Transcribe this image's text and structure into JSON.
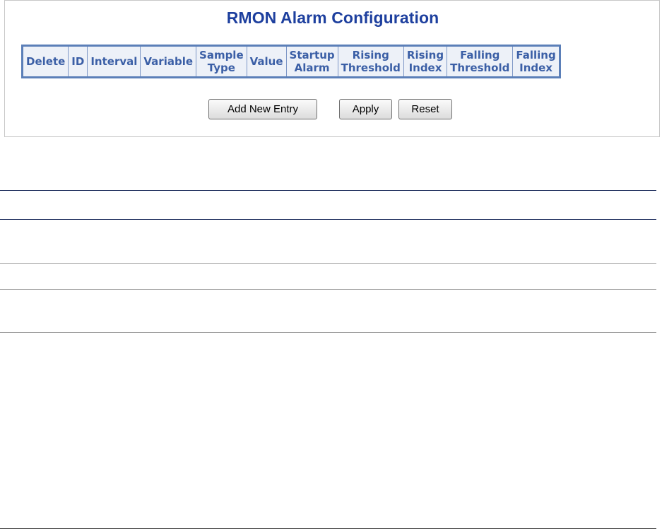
{
  "title": "RMON Alarm Configuration",
  "table": {
    "columns": [
      "Delete",
      "ID",
      "Interval",
      "Variable",
      "Sample\nType",
      "Value",
      "Startup\nAlarm",
      "Rising\nThreshold",
      "Rising\nIndex",
      "Falling\nThreshold",
      "Falling\nIndex"
    ],
    "rows": []
  },
  "buttons": {
    "add_new_entry": "Add New Entry",
    "apply": "Apply",
    "reset": "Reset"
  },
  "colors": {
    "title": "#1d3f9e",
    "header_text": "#3b5fa6",
    "header_bg": "#edf1f8",
    "table_border": "#5b7fb8"
  }
}
